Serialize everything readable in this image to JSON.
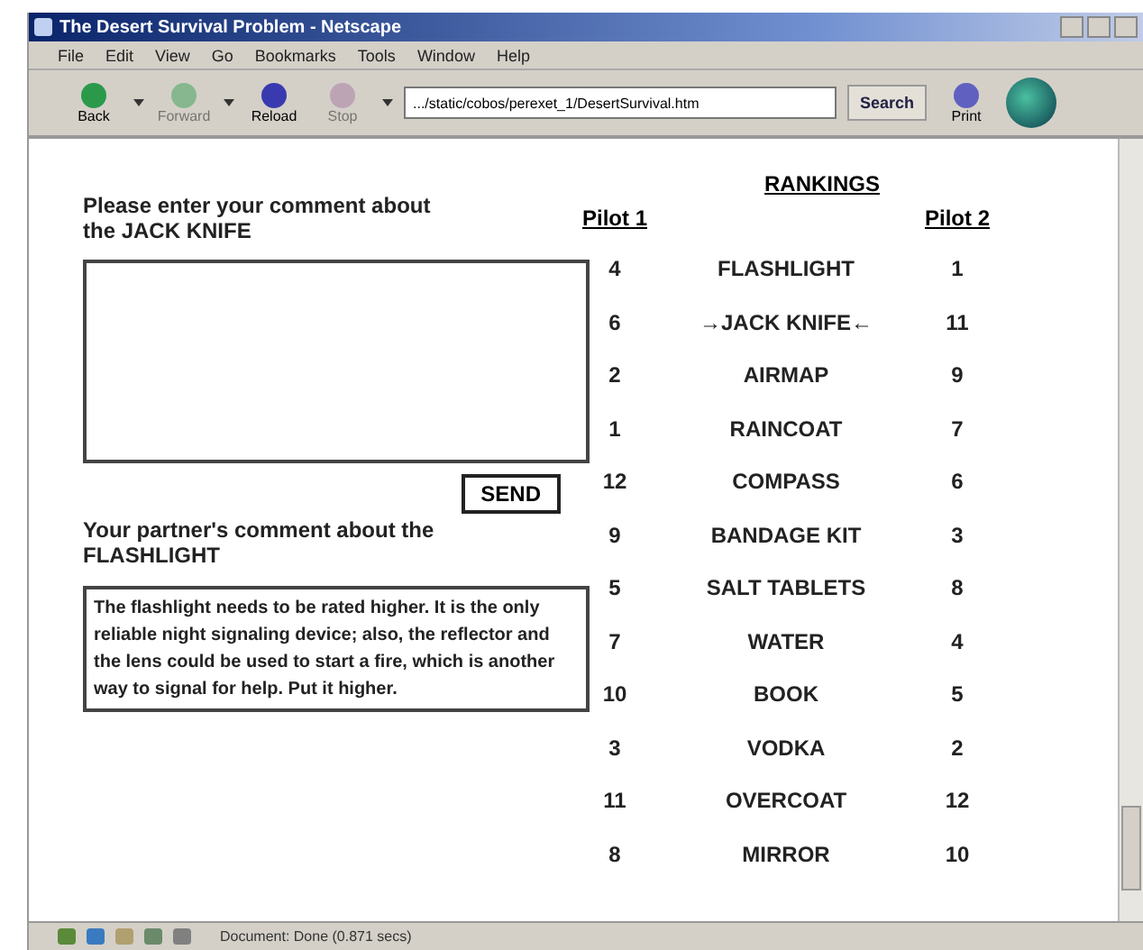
{
  "window": {
    "title": "The Desert Survival Problem - Netscape"
  },
  "menu": [
    "File",
    "Edit",
    "View",
    "Go",
    "Bookmarks",
    "Tools",
    "Window",
    "Help"
  ],
  "toolbar": {
    "buttons": [
      {
        "label": "Back",
        "disabled": false
      },
      {
        "label": "Forward",
        "disabled": true
      },
      {
        "label": "Reload",
        "disabled": false
      },
      {
        "label": "Stop",
        "disabled": true
      }
    ],
    "address": ".../static/cobos/perexet_1/DesertSurvival.htm",
    "search": "Search",
    "print": "Print"
  },
  "comment_prompt": "Please enter your comment about the JACK KNIFE",
  "send_button": "SEND",
  "partner_label": "Your partner's comment about the FLASHLIGHT",
  "partner_comment": "The flashlight needs to be rated higher. It is the only reliable night signaling device; also, the reflector and the lens could be used to start a fire, which is another way to signal for help.  Put it higher.",
  "rankings": {
    "title": "RANKINGS",
    "pilot1": "Pilot 1",
    "pilot2": "Pilot 2",
    "rows": [
      {
        "p1": "4",
        "item": "FLASHLIGHT",
        "p2": "1"
      },
      {
        "p1": "6",
        "item": "→JACK KNIFE←",
        "p2": "11"
      },
      {
        "p1": "2",
        "item": "AIRMAP",
        "p2": "9"
      },
      {
        "p1": "1",
        "item": "RAINCOAT",
        "p2": "7"
      },
      {
        "p1": "12",
        "item": "COMPASS",
        "p2": "6"
      },
      {
        "p1": "9",
        "item": "BANDAGE KIT",
        "p2": "3"
      },
      {
        "p1": "5",
        "item": "SALT TABLETS",
        "p2": "8"
      },
      {
        "p1": "7",
        "item": "WATER",
        "p2": "4"
      },
      {
        "p1": "10",
        "item": "BOOK",
        "p2": "5"
      },
      {
        "p1": "3",
        "item": "VODKA",
        "p2": "2"
      },
      {
        "p1": "11",
        "item": "OVERCOAT",
        "p2": "12"
      },
      {
        "p1": "8",
        "item": "MIRROR",
        "p2": "10"
      }
    ]
  },
  "status_bar": "Document: Done (0.871 secs)"
}
